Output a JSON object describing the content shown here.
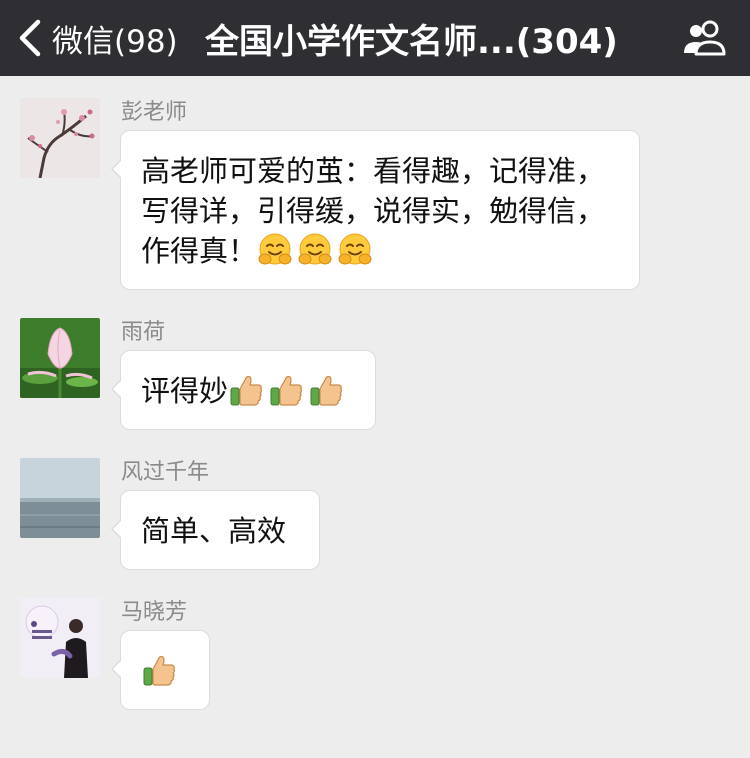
{
  "header": {
    "back_label": "微信(98)",
    "title": "全国小学作文名师...(304)",
    "back_icon": "chevron-left-icon",
    "members_icon": "group-members-icon"
  },
  "colors": {
    "header_bg": "#2e2e33",
    "chat_bg": "#ededed",
    "bubble_bg": "#ffffff",
    "sender_text": "#8a8a8a"
  },
  "messages": [
    {
      "sender": "彭老师",
      "text": "高老师可爱的茧：看得趣，记得准，写得详，引得缓，说得实，勉得信，作得真！",
      "emojis": [
        "hugging-face-icon",
        "hugging-face-icon",
        "hugging-face-icon"
      ]
    },
    {
      "sender": "雨荷",
      "text": "评得妙",
      "emojis": [
        "thumbs-up-icon",
        "thumbs-up-icon",
        "thumbs-up-icon"
      ]
    },
    {
      "sender": "风过千年",
      "text": "简单、高效",
      "emojis": []
    },
    {
      "sender": "马晓芳",
      "text": "",
      "emojis": [
        "thumbs-up-icon"
      ]
    }
  ]
}
